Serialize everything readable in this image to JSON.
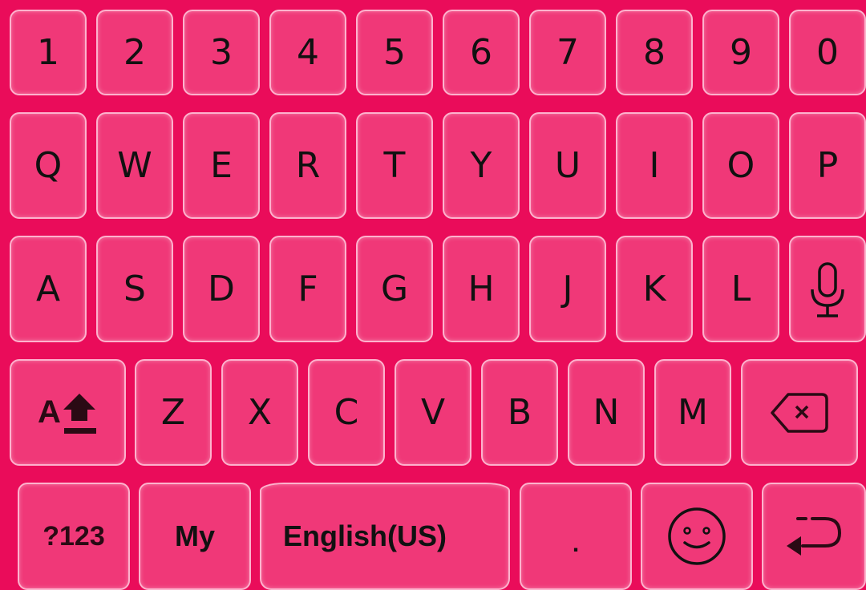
{
  "keyboard": {
    "theme": {
      "background": "#ea0c5a",
      "key": "#f03878",
      "text": "#111111"
    },
    "rows": [
      [
        "1",
        "2",
        "3",
        "4",
        "5",
        "6",
        "7",
        "8",
        "9",
        "0"
      ],
      [
        "Q",
        "W",
        "E",
        "R",
        "T",
        "Y",
        "U",
        "I",
        "O",
        "P"
      ],
      [
        "A",
        "S",
        "D",
        "F",
        "G",
        "H",
        "J",
        "K",
        "L"
      ],
      [
        "Z",
        "X",
        "C",
        "V",
        "B",
        "N",
        "M"
      ]
    ],
    "icons": {
      "mic": "microphone-icon",
      "shift": "shift-caps-icon",
      "backspace": "backspace-icon",
      "emoji": "emoji-smiley-icon",
      "enter": "enter-return-icon"
    },
    "bottom": {
      "symbols_label": "?123",
      "my_label": "My",
      "space_label": "English(US)",
      "period_label": "."
    }
  }
}
